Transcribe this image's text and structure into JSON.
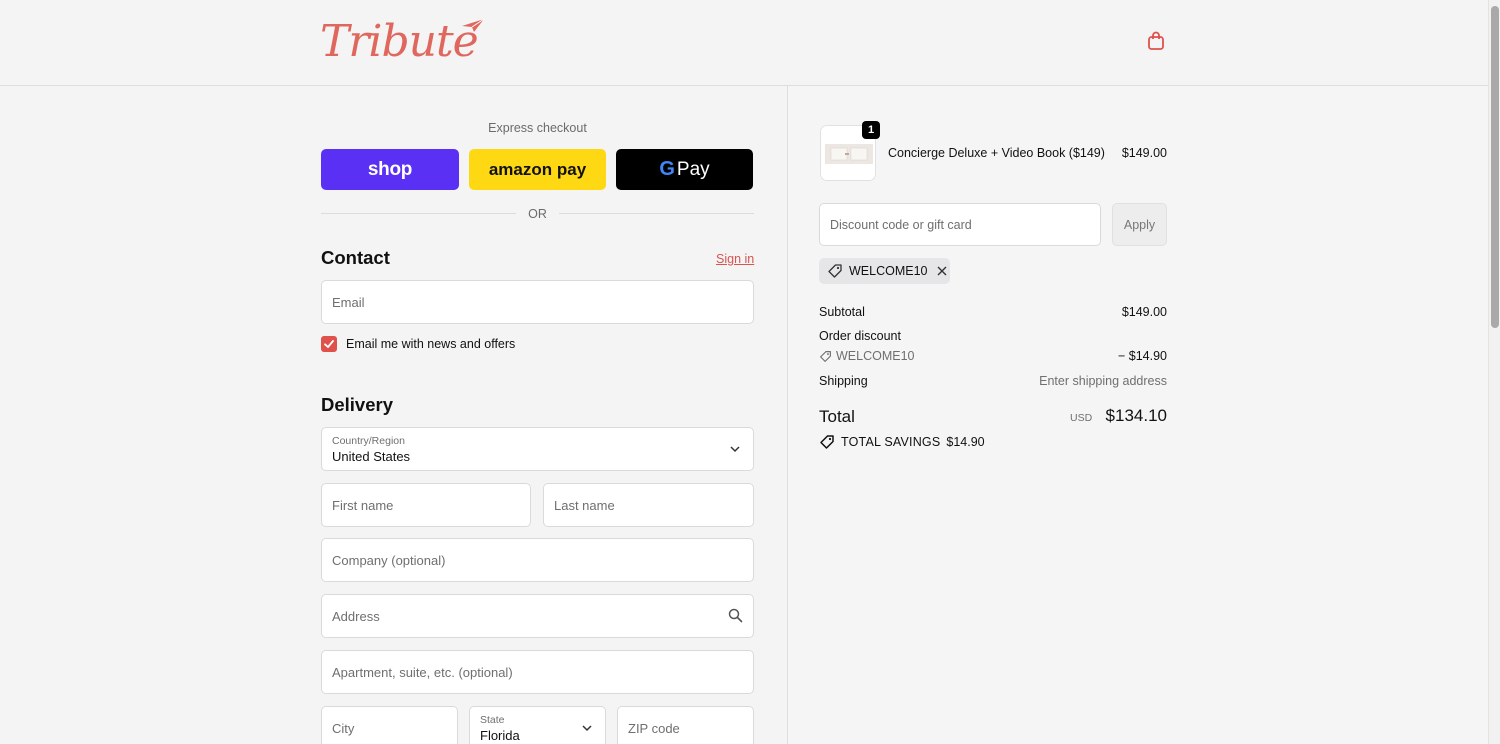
{
  "header": {
    "logo_text": "Tribute",
    "cart_icon": "shopping-bag-icon"
  },
  "express": {
    "title": "Express checkout",
    "shop_label": "shop",
    "amazon_label": "amazon pay",
    "gpay_g": "G",
    "gpay_label": "Pay",
    "or_label": "OR",
    "colors": {
      "shop": "#5a31f4",
      "amazon": "#ffd814",
      "gpay": "#000000"
    }
  },
  "contact": {
    "title": "Contact",
    "signin_label": "Sign in",
    "email_placeholder": "Email",
    "newsletter_label": "Email me with news and offers",
    "newsletter_checked": true
  },
  "delivery": {
    "title": "Delivery",
    "country_label": "Country/Region",
    "country_value": "United States",
    "first_name_placeholder": "First name",
    "last_name_placeholder": "Last name",
    "company_placeholder": "Company (optional)",
    "address_placeholder": "Address",
    "apartment_placeholder": "Apartment, suite, etc. (optional)",
    "city_placeholder": "City",
    "state_label": "State",
    "state_value": "Florida",
    "zip_placeholder": "ZIP code"
  },
  "summary": {
    "product": {
      "name": "Concierge Deluxe + Video Book ($149)",
      "price": "$149.00",
      "quantity": "1"
    },
    "discount_placeholder": "Discount code or gift card",
    "apply_label": "Apply",
    "applied_code": "WELCOME10",
    "subtotal_label": "Subtotal",
    "subtotal_value": "$149.00",
    "order_discount_label": "Order discount",
    "discount_code": "WELCOME10",
    "discount_value": "− $14.90",
    "shipping_label": "Shipping",
    "shipping_value": "Enter shipping address",
    "total_label": "Total",
    "total_currency": "USD",
    "total_value": "$134.10",
    "savings_label": "TOTAL SAVINGS",
    "savings_value": "$14.90"
  },
  "colors": {
    "accent": "#e0514b",
    "logo": "#e0675d"
  }
}
